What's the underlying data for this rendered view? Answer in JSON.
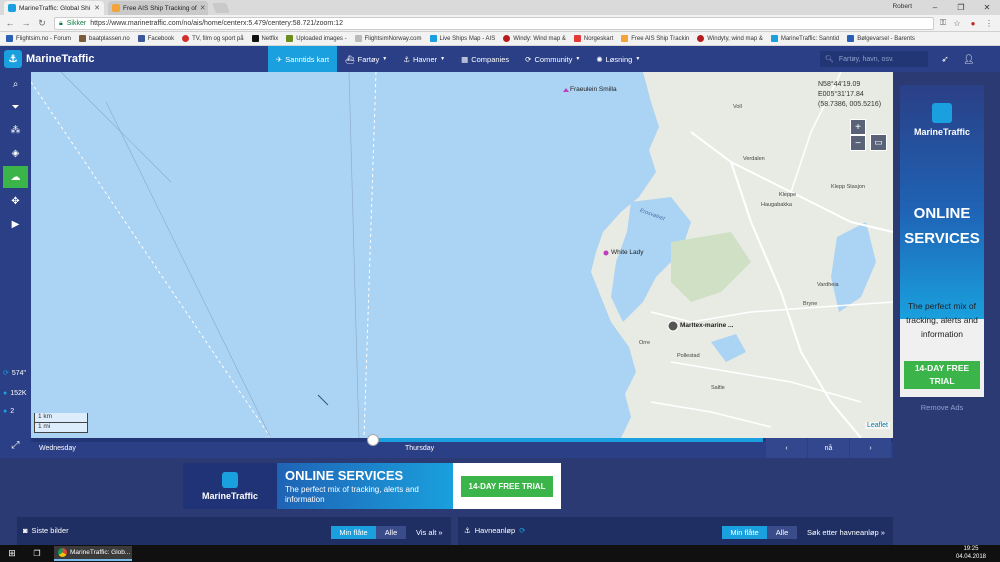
{
  "browser": {
    "tabs": [
      {
        "title": "MarineTraffic: Global Shi",
        "active": true
      },
      {
        "title": "Free AIS Ship Tracking of",
        "active": false
      }
    ],
    "user": "Robert",
    "secure_label": "Sikker",
    "url": "https://www.marinetraffic.com/no/ais/home/centerx:5.479/centery:58.721/zoom:12",
    "bookmarks": [
      "Flightsim.no - Forum",
      "baatplassen.no",
      "Facebook",
      "TV, film og sport på",
      "Netflix",
      "Uploaded images -",
      "FlightsimNorway.com",
      "Live Ships Map - AIS",
      "Windy: Wind map &",
      "Norgeskart",
      "Free AIS Ship Trackin",
      "Windyty, wind map &",
      "MarineTraffic: Sanntid",
      "Bølgevarsel - Barents"
    ]
  },
  "header": {
    "logo": "MarineTraffic",
    "nav": [
      {
        "label": "Sanntids kart",
        "active": true
      },
      {
        "label": "Fartøy",
        "caret": true
      },
      {
        "label": "Havner",
        "caret": true
      },
      {
        "label": "Companies",
        "caret": false
      },
      {
        "label": "Community",
        "caret": true
      },
      {
        "label": "Løsning",
        "caret": true
      }
    ],
    "search_placeholder": "Fartøy, havn, osv."
  },
  "sidebar": {
    "stats": [
      {
        "icon": "refresh-icon",
        "value": "574\""
      },
      {
        "icon": "info-icon",
        "value": "152K"
      },
      {
        "icon": "info-icon",
        "value": "2"
      }
    ]
  },
  "map": {
    "coords": [
      "N58°44'19.09",
      "E005°31'17.84",
      "(58.7386, 005.5216)"
    ],
    "scale": [
      "1 km",
      "1 mi"
    ],
    "attribution": "Leaflet",
    "vessels": [
      "Fraeulein Smilla",
      "White Lady"
    ],
    "port": "Marltex-marine ...",
    "places": [
      "Voll",
      "Verdalen",
      "Kleppe",
      "Haugabakka",
      "Klepp Stasjon",
      "Vardheia",
      "Bryne",
      "Orre",
      "Pollestad",
      "Saltle",
      "Erosvatnet"
    ]
  },
  "timeline": {
    "day_left": "Wednesday",
    "day_right": "Thursday",
    "prev": "‹",
    "now": "nå",
    "next": "›"
  },
  "right_ad": {
    "logo": "MarineTraffic",
    "title": "ONLINE SERVICES",
    "text": "The perfect mix of tracking, alerts and information",
    "button": "14-DAY FREE TRIAL",
    "remove": "Remove Ads"
  },
  "banner": {
    "logo": "MarineTraffic",
    "title": "ONLINE SERVICES",
    "subtitle": "The perfect mix of tracking, alerts and information",
    "button": "14-DAY FREE TRIAL"
  },
  "panels": {
    "left": {
      "title": "Siste bilder",
      "tab_on": "Min flåte",
      "tab_off": "Alle",
      "link": "Vis alt »"
    },
    "right": {
      "title": "Havneanløp",
      "tab_on": "Min flåte",
      "tab_off": "Alle",
      "link": "Søk etter havneanløp »"
    }
  },
  "taskbar": {
    "app": "MarineTraffic: Glob...",
    "time": "19:25",
    "date": "04.04.2018"
  },
  "colors": {
    "header": "#2a3f86",
    "accent": "#1aa0de",
    "green": "#3bb54a",
    "sea": "#aad3f4",
    "land": "#e8ebe3"
  }
}
